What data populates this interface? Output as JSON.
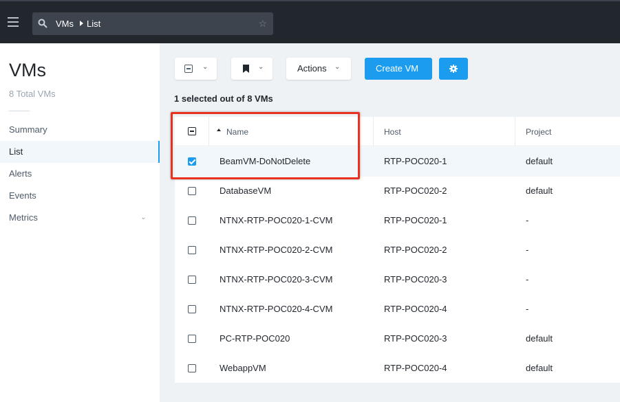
{
  "header": {
    "breadcrumb": [
      "VMs",
      "List"
    ],
    "icons": [
      "hamburger-icon",
      "search-icon",
      "star-icon"
    ]
  },
  "sidebar": {
    "title": "VMs",
    "subtitle": "8 Total VMs",
    "items": [
      {
        "label": "Summary",
        "active": false
      },
      {
        "label": "List",
        "active": true
      },
      {
        "label": "Alerts",
        "active": false
      },
      {
        "label": "Events",
        "active": false
      },
      {
        "label": "Metrics",
        "active": false,
        "expandable": true
      }
    ]
  },
  "toolbar": {
    "actions_label": "Actions",
    "create_label": "Create VM",
    "icons": [
      "select-all-icon",
      "bookmark-icon",
      "gear-icon"
    ]
  },
  "selection_info": "1 selected out of 8 VMs",
  "table": {
    "columns": [
      "Name",
      "Host",
      "Project"
    ],
    "sort": {
      "column": "Name",
      "direction": "ascending"
    },
    "rows": [
      {
        "name": "BeamVM-DoNotDelete",
        "host": "RTP-POC020-1",
        "project": "default",
        "checked": true
      },
      {
        "name": "DatabaseVM",
        "host": "RTP-POC020-2",
        "project": "default",
        "checked": false
      },
      {
        "name": "NTNX-RTP-POC020-1-CVM",
        "host": "RTP-POC020-1",
        "project": "-",
        "checked": false
      },
      {
        "name": "NTNX-RTP-POC020-2-CVM",
        "host": "RTP-POC020-2",
        "project": "-",
        "checked": false
      },
      {
        "name": "NTNX-RTP-POC020-3-CVM",
        "host": "RTP-POC020-3",
        "project": "-",
        "checked": false
      },
      {
        "name": "NTNX-RTP-POC020-4-CVM",
        "host": "RTP-POC020-4",
        "project": "-",
        "checked": false
      },
      {
        "name": "PC-RTP-POC020",
        "host": "RTP-POC020-3",
        "project": "default",
        "checked": false
      },
      {
        "name": "WebappVM",
        "host": "RTP-POC020-4",
        "project": "default",
        "checked": false
      }
    ]
  },
  "colors": {
    "accent": "#1b9cef",
    "topbar": "#22272e",
    "highlight": "#e8321f"
  }
}
